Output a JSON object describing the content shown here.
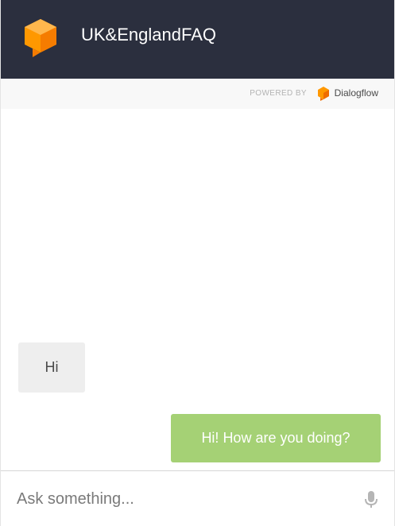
{
  "header": {
    "title": "UK&EnglandFAQ",
    "logo_icon": "dialogflow-cube-icon",
    "background_color": "#2b2f3e"
  },
  "powered_by": {
    "label": "POWERED BY",
    "brand_name": "Dialogflow",
    "brand_icon": "dialogflow-logo-icon"
  },
  "chat": {
    "messages": [
      {
        "sender": "user",
        "text": "Hi",
        "bubble_color": "#eeeeee"
      },
      {
        "sender": "agent",
        "text": "Hi! How are you doing?",
        "bubble_color": "#a5d175"
      }
    ]
  },
  "input": {
    "placeholder": "Ask something...",
    "value": "",
    "mic_icon": "microphone-icon"
  },
  "colors": {
    "brand_orange": "#ff9800",
    "brand_orange_dark": "#ef6c00"
  }
}
